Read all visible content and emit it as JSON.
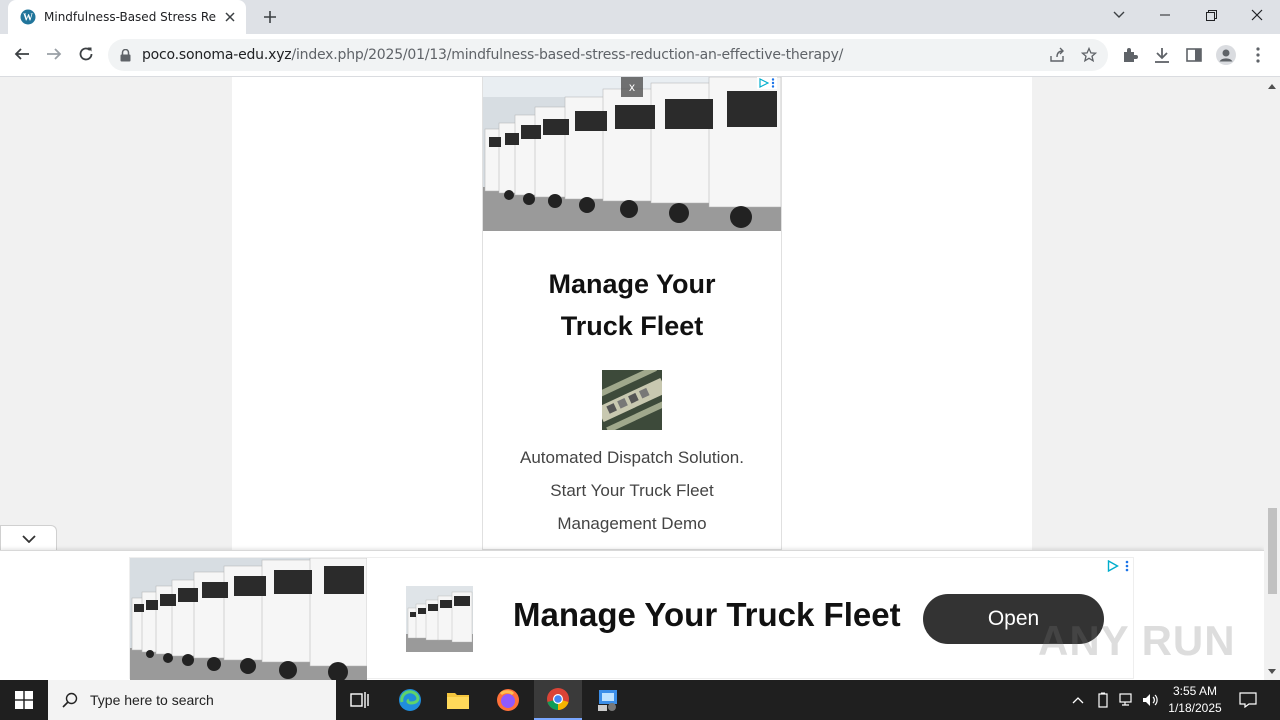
{
  "browser": {
    "tab_title": "Mindfulness-Based Stress Reduc",
    "url_host": "poco.sonoma-edu.xyz",
    "url_path": "/index.php/2025/01/13/mindfulness-based-stress-reduction-an-effective-therapy/"
  },
  "ad_card": {
    "close_label": "x",
    "headline_line1": "Manage Your",
    "headline_line2": "Truck Fleet",
    "desc_line1": "Automated Dispatch Solution.",
    "desc_line2": "Start Your Truck Fleet",
    "desc_line3": "Management Demo"
  },
  "anchor_ad": {
    "headline": "Manage Your Truck Fleet",
    "open_label": "Open"
  },
  "watermark": "ANY RUN",
  "taskbar": {
    "search_placeholder": "Type here to search",
    "time": "3:55 AM",
    "date": "1/18/2025"
  },
  "colors": {
    "tabstrip": "#dee1e6",
    "page_bg": "#f1f1f1",
    "open_button": "#333333",
    "taskbar": "#1f1f1f"
  }
}
